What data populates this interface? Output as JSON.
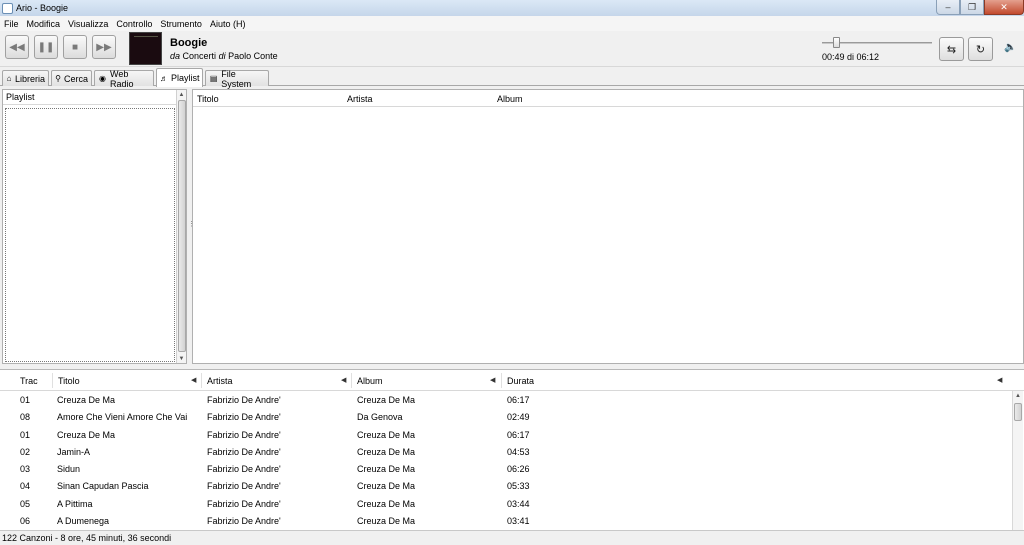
{
  "window": {
    "title": "Ario - Boogie"
  },
  "menu": [
    "File",
    "Modifica",
    "Visualizza",
    "Controllo",
    "Strumento",
    "Aiuto (H)"
  ],
  "now_playing": {
    "title": "Boogie",
    "from_word": "da",
    "album": "Concerti",
    "by_word": "di",
    "artist": "Paolo Conte",
    "time": "00:49 di 06:12",
    "progress": 0.13
  },
  "tabs": [
    {
      "label": "Libreria",
      "icon": "home-icon"
    },
    {
      "label": "Cerca",
      "icon": "magnifier-icon"
    },
    {
      "label": "Web Radio",
      "icon": "radio-icon"
    },
    {
      "label": "Playlist",
      "icon": "playlist-icon",
      "active": true
    },
    {
      "label": "File System",
      "icon": "folder-icon"
    }
  ],
  "left_panel": {
    "header": "Playlist"
  },
  "right_panel": {
    "columns": [
      "Titolo",
      "Artista",
      "Album"
    ]
  },
  "queue": {
    "columns": [
      "Trac",
      "Titolo",
      "Artista",
      "Album",
      "Durata"
    ],
    "rows": [
      [
        "01",
        "Creuza De Ma",
        "Fabrizio De Andre'",
        "Creuza De Ma",
        "06:17"
      ],
      [
        "08",
        "Amore Che Vieni Amore Che Vai",
        "Fabrizio De Andre'",
        "Da Genova",
        "02:49"
      ],
      [
        "01",
        "Creuza De Ma",
        "Fabrizio De Andre'",
        "Creuza De Ma",
        "06:17"
      ],
      [
        "02",
        "Jamin-A",
        "Fabrizio De Andre'",
        "Creuza De Ma",
        "04:53"
      ],
      [
        "03",
        "Sidun",
        "Fabrizio De Andre'",
        "Creuza De Ma",
        "06:26"
      ],
      [
        "04",
        "Sinan Capudan Pascia",
        "Fabrizio De Andre'",
        "Creuza De Ma",
        "05:33"
      ],
      [
        "05",
        "A Pittima",
        "Fabrizio De Andre'",
        "Creuza De Ma",
        "03:44"
      ],
      [
        "06",
        "A Dumenega",
        "Fabrizio De Andre'",
        "Creuza De Ma",
        "03:41"
      ]
    ]
  },
  "status": "122 Canzoni - 8 ore, 45 minuti, 36 secondi"
}
